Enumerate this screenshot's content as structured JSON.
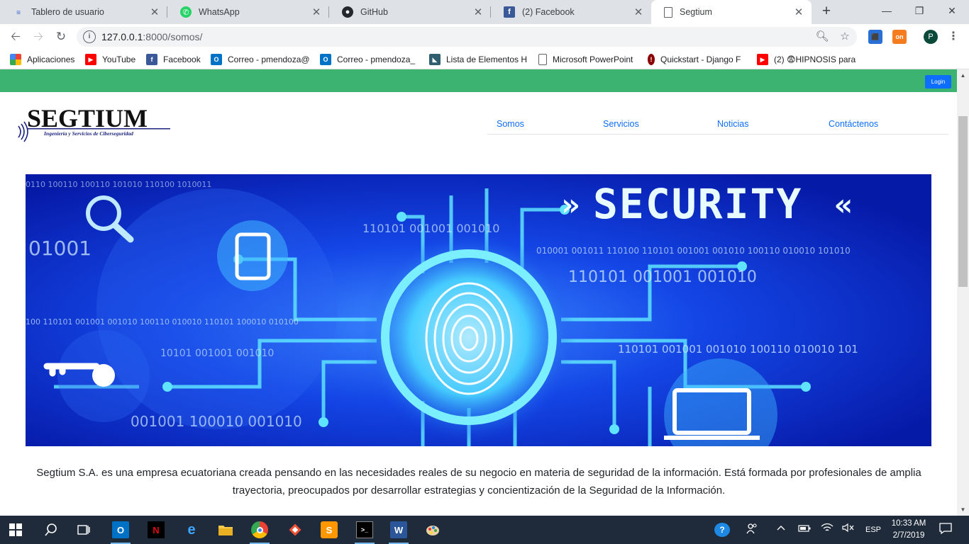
{
  "browser": {
    "tabs": [
      {
        "title": "Tablero de usuario",
        "favicon": "segtium-favicon"
      },
      {
        "title": "WhatsApp",
        "favicon": "whatsapp-icon"
      },
      {
        "title": "GitHub",
        "favicon": "github-icon"
      },
      {
        "title": "(2) Facebook",
        "favicon": "facebook-icon"
      },
      {
        "title": "Segtium",
        "favicon": "page-icon",
        "active": true
      }
    ],
    "new_tab": "+",
    "window_controls": {
      "minimize": "—",
      "maximize": "❐",
      "close": "✕"
    },
    "address": {
      "host": "127.0.0.1",
      "path": ":8000/somos/"
    },
    "profile_initial": "P",
    "extension_badge": "on",
    "bookmarks": [
      {
        "label": "Aplicaciones",
        "icon": "apps-grid-icon"
      },
      {
        "label": "YouTube",
        "icon": "youtube-icon"
      },
      {
        "label": "Facebook",
        "icon": "facebook-icon"
      },
      {
        "label": "Correo - pmendoza@",
        "icon": "outlook-icon"
      },
      {
        "label": "Correo - pmendoza_",
        "icon": "outlook-icon"
      },
      {
        "label": "Lista de Elementos H",
        "icon": "list-icon"
      },
      {
        "label": "Microsoft PowerPoint",
        "icon": "document-icon"
      },
      {
        "label": "Quickstart - Django F",
        "icon": "django-icon"
      },
      {
        "label": "(2) 😨HIPNOSIS para",
        "icon": "youtube-icon"
      }
    ]
  },
  "site": {
    "login_label": "Login",
    "logo": {
      "name": "SEGTIUM",
      "tagline": "Ingeniería y Servicios de Ciberseguridad"
    },
    "nav": [
      "Somos",
      "Servicios",
      "Noticias",
      "Contáctenos"
    ],
    "hero": {
      "title": "SECURITY",
      "binary": [
        "0110 100110 100110 101010 110100 1010011",
        "01001",
        "110101 001001 001010",
        "010001 001011 110100 110101 001001 001010 100110 010010 101010",
        "110101 001001 001010",
        "100 110101 001001 001010 100110 010010 110101 100010 010100",
        "10101 001001 001010",
        "110101 001001 001010 100110 010010 101",
        "001001 100010 001010"
      ]
    },
    "intro": "Segtium S.A. es una empresa ecuatoriana creada pensando en las necesidades reales de su negocio en materia de seguridad de la información. Está formada por profesionales de amplia trayectoria, preocupados por desarrollar estrategias y concientización de la Seguridad de la Información."
  },
  "taskbar": {
    "apps": [
      "windows-start-icon",
      "search-icon",
      "task-view-icon",
      "outlook-icon",
      "netflix-icon",
      "edge-icon",
      "file-explorer-icon",
      "chrome-icon",
      "git-icon",
      "sublime-icon",
      "terminal-icon",
      "word-icon",
      "paint-icon"
    ],
    "tray": {
      "help": "?",
      "language": "ESP"
    },
    "clock": {
      "time": "10:33 AM",
      "date": "2/7/2019"
    }
  },
  "colors": {
    "green_bar": "#3cb371",
    "nav_link": "#0d6efd",
    "hero_blue": "#0a2bd6",
    "taskbar": "#1f2b3a"
  }
}
